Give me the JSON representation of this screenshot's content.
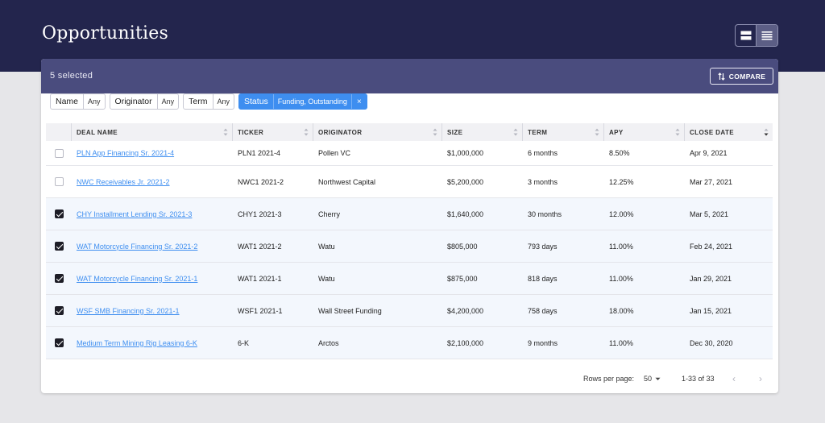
{
  "page": {
    "title": "Opportunities"
  },
  "colors": {
    "topbar": "#23254d",
    "card_header": "#4a4c7e",
    "accent": "#3e8ef0"
  },
  "view_toggle": {
    "options": [
      "split-view-icon",
      "list-view-icon"
    ],
    "active": "list-view-icon"
  },
  "selection": {
    "count_label": "5 selected"
  },
  "compare": {
    "label": "COMPARE",
    "icon": "sort-arrows-icon"
  },
  "filters": [
    {
      "label": "Name",
      "value": "Any",
      "active": false
    },
    {
      "label": "Originator",
      "value": "Any",
      "active": false
    },
    {
      "label": "Term",
      "value": "Any",
      "active": false
    },
    {
      "label": "Status",
      "value": "Funding, Outstanding",
      "active": true,
      "clear": "×"
    }
  ],
  "table": {
    "columns": [
      "DEAL NAME",
      "TICKER",
      "ORIGINATOR",
      "SIZE",
      "TERM",
      "APY",
      "CLOSE DATE"
    ],
    "sorted_column": "CLOSE DATE",
    "rows": [
      {
        "checked": false,
        "name": "PLN App Financing Sr. 2021-4",
        "ticker": "PLN1 2021-4",
        "originator": "Pollen VC",
        "size": "$1,000,000",
        "term": "6 months",
        "apy": "8.50%",
        "close": "Apr 9, 2021"
      },
      {
        "checked": false,
        "name": "NWC Receivables Jr. 2021-2",
        "ticker": "NWC1 2021-2",
        "originator": "Northwest Capital",
        "size": "$5,200,000",
        "term": "3 months",
        "apy": "12.25%",
        "close": "Mar 27, 2021"
      },
      {
        "checked": true,
        "name": "CHY Installment Lending Sr. 2021-3",
        "ticker": "CHY1 2021-3",
        "originator": "Cherry",
        "size": "$1,640,000",
        "term": "30 months",
        "apy": "12.00%",
        "close": "Mar 5, 2021"
      },
      {
        "checked": true,
        "name": "WAT Motorcycle Financing Sr. 2021-2",
        "ticker": "WAT1 2021-2",
        "originator": "Watu",
        "size": "$805,000",
        "term": "793 days",
        "apy": "11.00%",
        "close": "Feb 24, 2021"
      },
      {
        "checked": true,
        "name": "WAT Motorcycle Financing Sr. 2021-1",
        "ticker": "WAT1 2021-1",
        "originator": "Watu",
        "size": "$875,000",
        "term": "818 days",
        "apy": "11.00%",
        "close": "Jan 29, 2021"
      },
      {
        "checked": true,
        "name": "WSF SMB Financing Sr. 2021-1",
        "ticker": "WSF1 2021-1",
        "originator": "Wall Street Funding",
        "size": "$4,200,000",
        "term": "758 days",
        "apy": "18.00%",
        "close": "Jan 15, 2021"
      },
      {
        "checked": true,
        "name": "Medium Term Mining Rig Leasing 6-K",
        "ticker": "6-K",
        "originator": "Arctos",
        "size": "$2,100,000",
        "term": "9 months",
        "apy": "11.00%",
        "close": "Dec 30, 2020"
      }
    ]
  },
  "pagination": {
    "rows_per_page_label": "Rows per page:",
    "rows_per_page": "50",
    "range": "1-33 of 33",
    "prev": "‹",
    "next": "›"
  }
}
